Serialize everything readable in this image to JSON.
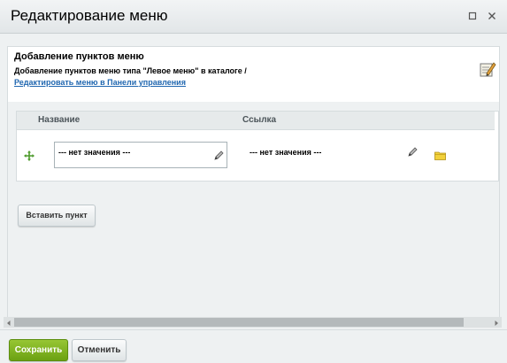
{
  "window": {
    "title": "Редактирование меню",
    "maximize_icon": "maximize-icon",
    "close_icon": "close-icon"
  },
  "panel": {
    "section_title": "Добавление пунктов меню",
    "description": "Добавление пунктов меню типа \"Левое меню\" в каталоге /",
    "edit_link": "Редактировать меню в Панели управления",
    "header_icon": "notepad-pencil-icon"
  },
  "table": {
    "columns": {
      "name": "Название",
      "link": "Ссылка"
    },
    "rows": [
      {
        "name_value": "--- нет значения ---",
        "link_value": "--- нет значения ---"
      }
    ]
  },
  "buttons": {
    "add_item": "Вставить пункт",
    "save": "Сохранить",
    "cancel": "Отменить"
  },
  "colors": {
    "save_button": "#7db41f",
    "link": "#2067b0",
    "background": "#eef1f2"
  }
}
